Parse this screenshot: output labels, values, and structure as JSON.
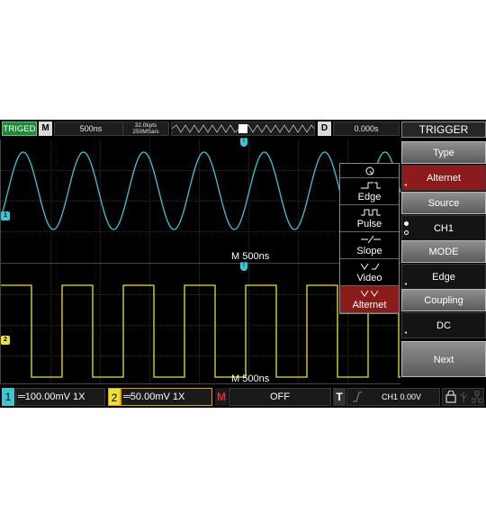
{
  "topbar": {
    "trig_status": "TRIGED",
    "mode_badge": "M",
    "timebase": "500ns",
    "mem_depth": "32.0kpts",
    "sample_rate": "250MSa/s",
    "delay_badge": "D",
    "delay": "0.000s"
  },
  "waveforms": {
    "ch1_marker": "1",
    "ch2_marker": "2",
    "trig_marker": "T",
    "ch1_timelabel": "M 500ns",
    "ch2_timelabel": "M 500ns",
    "colors": {
      "ch1": "#3ec6d2",
      "ch2": "#e6e23a"
    }
  },
  "type_menu": {
    "items": [
      {
        "label": "Edge",
        "icon": "edge-trigger-icon"
      },
      {
        "label": "Pulse",
        "icon": "pulse-trigger-icon"
      },
      {
        "label": "Slope",
        "icon": "slope-trigger-icon"
      },
      {
        "label": "Video",
        "icon": "video-trigger-icon"
      },
      {
        "label": "Alternet",
        "icon": "alternate-trigger-icon",
        "selected": true
      }
    ]
  },
  "panel": {
    "title": "TRIGGER",
    "type_label": "Type",
    "type_value": "Alternet",
    "source_label": "Source",
    "source_value": "CH1",
    "mode_label": "MODE",
    "mode_value": "Edge",
    "coupling_label": "Coupling",
    "coupling_value": "DC",
    "next_label": "Next"
  },
  "bottombar": {
    "ch1_num": "1",
    "ch1_setting": "═100.00mV 1X",
    "ch2_num": "2",
    "ch2_setting": "═50.00mV 1X",
    "math_badge": "M",
    "math_value": "OFF",
    "trig_badge": "T",
    "trig_info": "CH1 0.00V"
  }
}
